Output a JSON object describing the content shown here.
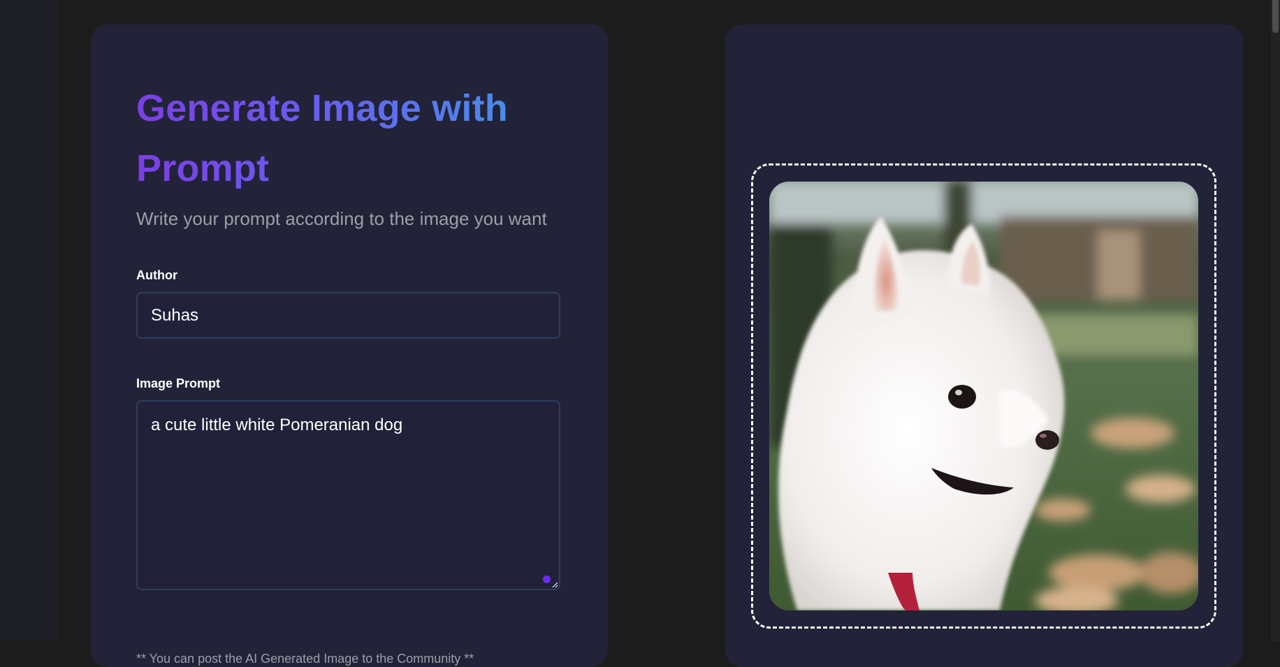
{
  "form": {
    "title": "Generate Image with Prompt",
    "subtitle": "Write your prompt according to the image you want",
    "author_label": "Author",
    "author_value": "Suhas",
    "prompt_label": "Image Prompt",
    "prompt_value": "a cute little white Pomeranian dog",
    "footnote": "** You can post the AI Generated Image to the Community **"
  },
  "preview": {
    "image_subject": "white Pomeranian dog on grass",
    "icons": [
      "resize-grip-icon"
    ]
  },
  "colors": {
    "page_background": "#1c1c1c",
    "card_background": "#222338",
    "title_gradient_start": "#7b3fe4",
    "title_gradient_end": "#3f9be8",
    "input_border": "#2f3e5c",
    "accent_dot": "#6b2cf5",
    "muted_text": "#9e9ea9"
  }
}
